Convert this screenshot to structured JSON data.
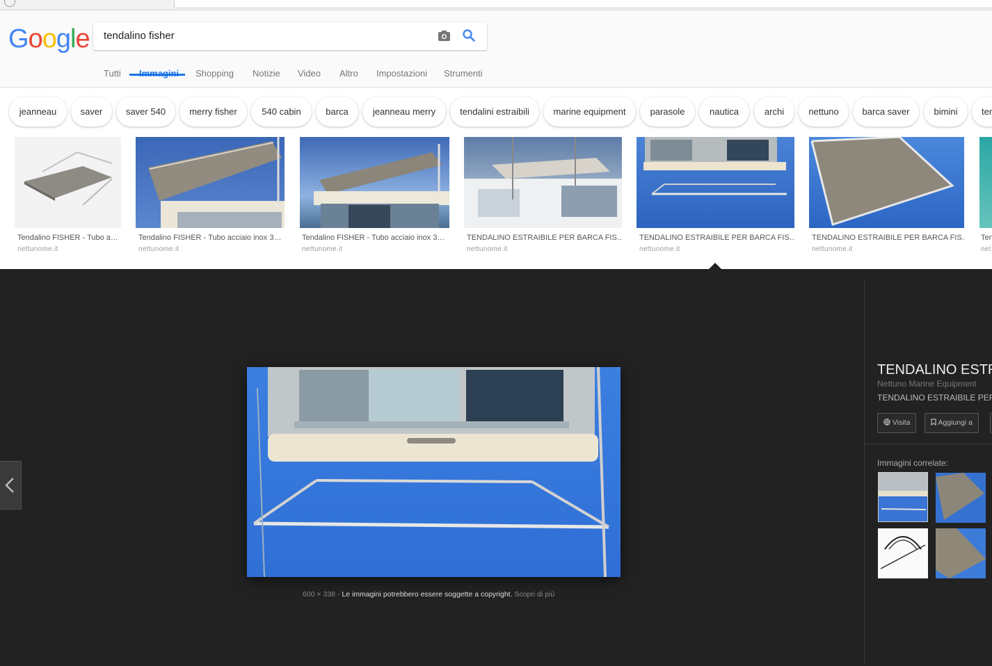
{
  "colors": {
    "accent": "#1a73e8",
    "viewer_bg": "#222222"
  },
  "logo": {
    "letters": [
      "G",
      "o",
      "o",
      "g",
      "l",
      "e"
    ],
    "colors": [
      "#4285F4",
      "#EA4335",
      "#FBBC05",
      "#4285F4",
      "#34A853",
      "#EA4335"
    ]
  },
  "search": {
    "query": "tendalino fisher",
    "camera_icon": "camera-icon",
    "search_icon": "search-icon"
  },
  "tabs": [
    {
      "label": "Tutti"
    },
    {
      "label": "Immagini",
      "active": true
    },
    {
      "label": "Shopping"
    },
    {
      "label": "Notizie"
    },
    {
      "label": "Video"
    },
    {
      "label": "Altro"
    },
    {
      "label": "Impostazioni"
    },
    {
      "label": "Strumenti"
    }
  ],
  "chips": [
    "jeanneau",
    "saver",
    "saver 540",
    "merry fisher",
    "540 cabin",
    "barca",
    "jeanneau merry",
    "tendalini estraibili",
    "marine equipment",
    "parasole",
    "nautica",
    "archi",
    "nettuno",
    "barca saver",
    "bimini",
    "ten"
  ],
  "results": [
    {
      "caption": "Tendalino FISHER - Tubo a…",
      "source": "nettunome.it"
    },
    {
      "caption": "Tendalino FISHER - Tubo acciaio inox 3…",
      "source": "nettunome.it"
    },
    {
      "caption": "Tendalino FISHER - Tubo acciaio inox 3…",
      "source": "nettunome.it"
    },
    {
      "caption": "TENDALINO ESTRAIBILE PER BARCA FIS…",
      "source": "nettunome.it"
    },
    {
      "caption": "TENDALINO ESTRAIBILE PER BARCA FIS…",
      "source": "nettunome.it"
    },
    {
      "caption": "TENDALINO ESTRAIBILE PER BARCA FIS…",
      "source": "nettunome.it"
    },
    {
      "caption": "Ten",
      "source": "net"
    }
  ],
  "viewer": {
    "dimensions": "600 × 338",
    "separator": "-",
    "copyright": "Le immagini potrebbero essere soggette a copyright.",
    "learn_more": "Scopri di più",
    "title": "TENDALINO ESTR",
    "site": "Nettuno Marine Equipment",
    "description": "TENDALINO ESTRAIBILE PER",
    "visit_label": "Visita",
    "save_label": "Aggiungi a",
    "related_label": "Immagini correlate:"
  }
}
